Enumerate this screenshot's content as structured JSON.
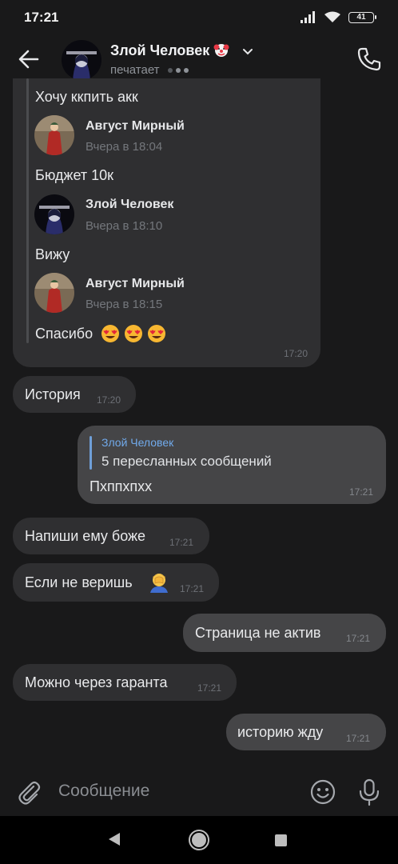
{
  "status": {
    "time": "17:21",
    "battery": "41"
  },
  "header": {
    "name": "Злой Человек",
    "status": "печатает",
    "avatar_icon": "dark-hooded-figure-avatar"
  },
  "forwarded": {
    "items": [
      {
        "type": "text",
        "text": "Хочу ккпить акк"
      },
      {
        "type": "author",
        "name": "Август Мирный",
        "date": "Вчера в 18:04",
        "avatar": "joker-red-suit-avatar"
      },
      {
        "type": "text",
        "text": "Бюджет 10к"
      },
      {
        "type": "author",
        "name": "Злой Человек",
        "date": "Вчера в 18:10",
        "avatar": "dark-hooded-figure-avatar"
      },
      {
        "type": "text",
        "text": "Вижу"
      },
      {
        "type": "author",
        "name": "Август Мирный",
        "date": "Вчера в 18:15",
        "avatar": "joker-red-suit-avatar"
      },
      {
        "type": "text",
        "text": "Спасибо"
      }
    ],
    "time": "17:20"
  },
  "messages": [
    {
      "dir": "in",
      "text": "История",
      "time": "17:20"
    },
    {
      "dir": "out",
      "reply_author": "Злой Человек",
      "reply_preview": "5 пересланных сообщений",
      "text": "Пхппхпхх",
      "time": "17:21"
    },
    {
      "dir": "in",
      "text": "Напиши ему боже",
      "time": "17:21"
    },
    {
      "dir": "in",
      "text": "Если не веришь",
      "time": "17:21",
      "emoji": "man-facepalming"
    },
    {
      "dir": "out",
      "text": "Страница не актив",
      "time": "17:21"
    },
    {
      "dir": "in",
      "text": "Можно через гаранта",
      "time": "17:21"
    },
    {
      "dir": "out",
      "text": "историю жду",
      "time": "17:21"
    }
  ],
  "composer": {
    "placeholder": "Сообщение"
  },
  "colors": {
    "background": "#19191a",
    "bubble_in": "#2f2f31",
    "bubble_out": "#454547",
    "reply_accent": "#71aaeb"
  }
}
